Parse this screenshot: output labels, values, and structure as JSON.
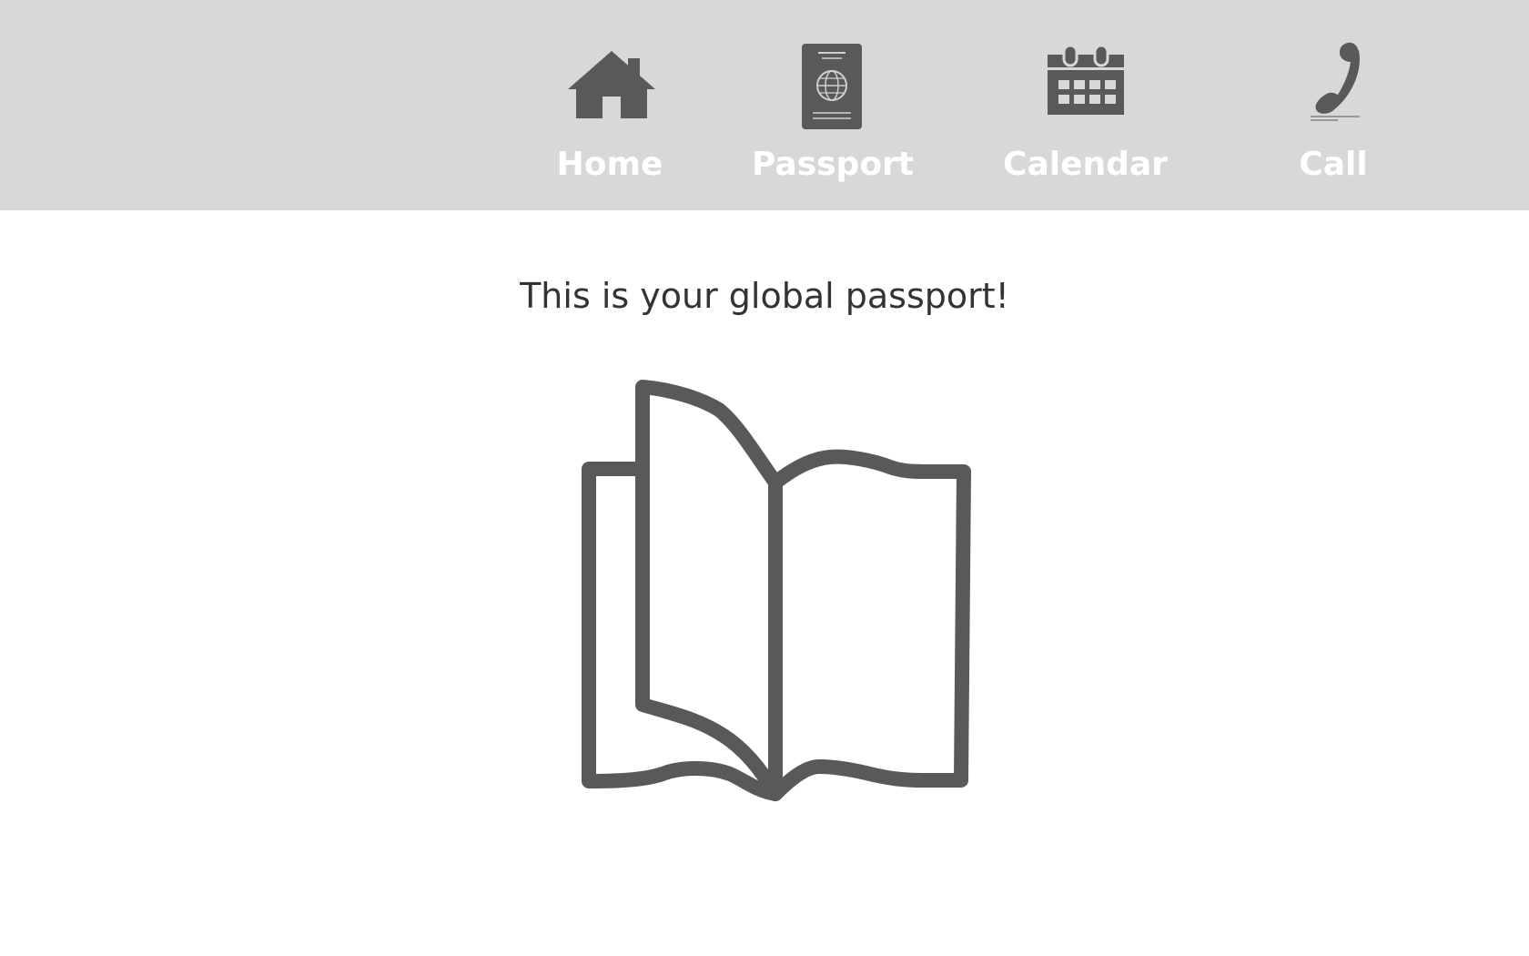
{
  "nav": {
    "items": [
      {
        "label": "Home",
        "icon": "house-icon"
      },
      {
        "label": "Passport",
        "icon": "passport-icon"
      },
      {
        "label": "Calendar",
        "icon": "calendar-icon"
      },
      {
        "label": "Call",
        "icon": "phone-icon"
      }
    ]
  },
  "main": {
    "message": "This is your global passport!",
    "illustration": "open-book-icon"
  },
  "colors": {
    "nav_background": "#d8d8d8",
    "nav_label": "#ffffff",
    "icon": "#595959",
    "text": "#333333"
  }
}
